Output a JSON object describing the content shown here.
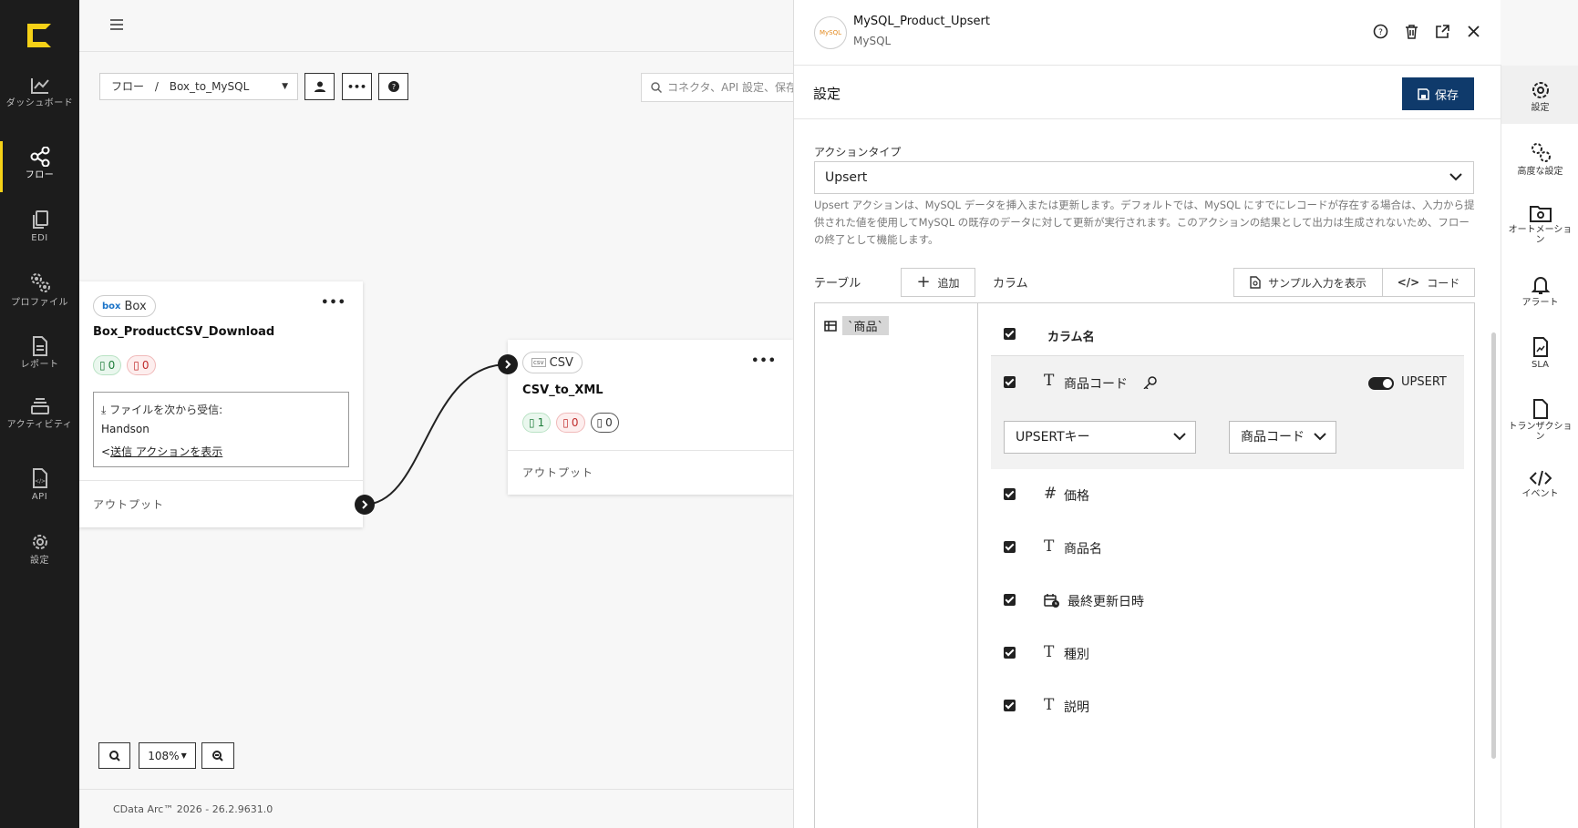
{
  "nav": {
    "items": [
      {
        "label": "ダッシュボード",
        "icon": "chart-line-icon"
      },
      {
        "label": "フロー",
        "icon": "share-nodes-icon"
      },
      {
        "label": "EDI",
        "icon": "documents-icon"
      },
      {
        "label": "プロファイル",
        "icon": "gears-icon"
      },
      {
        "label": "レポート",
        "icon": "report-icon"
      },
      {
        "label": "アクティビティ",
        "icon": "layers-icon"
      },
      {
        "label": "API",
        "icon": "api-file-icon"
      },
      {
        "label": "設定",
        "icon": "gear-icon"
      }
    ],
    "active": "フロー"
  },
  "canvas": {
    "breadcrumb": {
      "root": "フロー",
      "separator": "/",
      "current": "Box_to_MySQL"
    },
    "search_placeholder": "コネクタ、API 設定、保存",
    "zoom": "108%",
    "footer": "CData Arc™ 2026 - 26.2.9631.0"
  },
  "nodes": {
    "box": {
      "badge": "Box",
      "badge_logo": "box",
      "title": "Box_ProductCSV_Download",
      "success": "0",
      "error": "0",
      "receive_label": "ファイルを次から受信:",
      "receive_from": "Handson",
      "link": "送信 アクションを表示",
      "output": "アウトプット"
    },
    "csv": {
      "badge": "CSV",
      "badge_logo": "csv",
      "title": "CSV_to_XML",
      "success": "1",
      "error": "0",
      "pending": "0",
      "output": "アウトプット"
    }
  },
  "panel": {
    "title": "MySQL_Product_Upsert",
    "subtitle": "MySQL",
    "avatar_text": "MySQL",
    "section_title": "設定",
    "save_label": "保存",
    "action_type_label": "アクションタイプ",
    "action_type_value": "Upsert",
    "description": "Upsert アクションは、MySQL データを挿入または更新します。デフォルトでは、MySQL にすでにレコードが存在する場合は、入力から提供された値を使用してMySQL の既存のデータに対して更新が実行されます。このアクションの結果として出力は生成されないため、フローの終了として機能します。",
    "table_label": "テーブル",
    "add_label": "追加",
    "column_label": "カラム",
    "sample_label": "サンプル入力を表示",
    "code_label": "コード",
    "table_name": "`商品`",
    "column_header": "カラム名",
    "upsert_column": {
      "type": "T",
      "name": "商品コード",
      "toggle_label": "UPSERT",
      "key_select": "UPSERTキー",
      "key_column": "商品コード"
    },
    "columns": [
      {
        "type": "#",
        "name": "価格"
      },
      {
        "type": "T",
        "name": "商品名"
      },
      {
        "type": "date",
        "name": "最終更新日時"
      },
      {
        "type": "T",
        "name": "種別"
      },
      {
        "type": "T",
        "name": "説明"
      }
    ]
  },
  "side_tabs": [
    {
      "label": "設定",
      "icon": "gear-icon"
    },
    {
      "label": "高度な設定",
      "icon": "gears-icon"
    },
    {
      "label": "オートメーション",
      "icon": "folder-gear-icon"
    },
    {
      "label": "アラート",
      "icon": "bell-icon"
    },
    {
      "label": "SLA",
      "icon": "sla-file-icon"
    },
    {
      "label": "トランザクション",
      "icon": "file-icon"
    },
    {
      "label": "イベント",
      "icon": "code-icon"
    }
  ],
  "colors": {
    "accent": "#f5d117",
    "nav_bg": "#1c1c1c",
    "save_bg": "#0f3a6b"
  }
}
